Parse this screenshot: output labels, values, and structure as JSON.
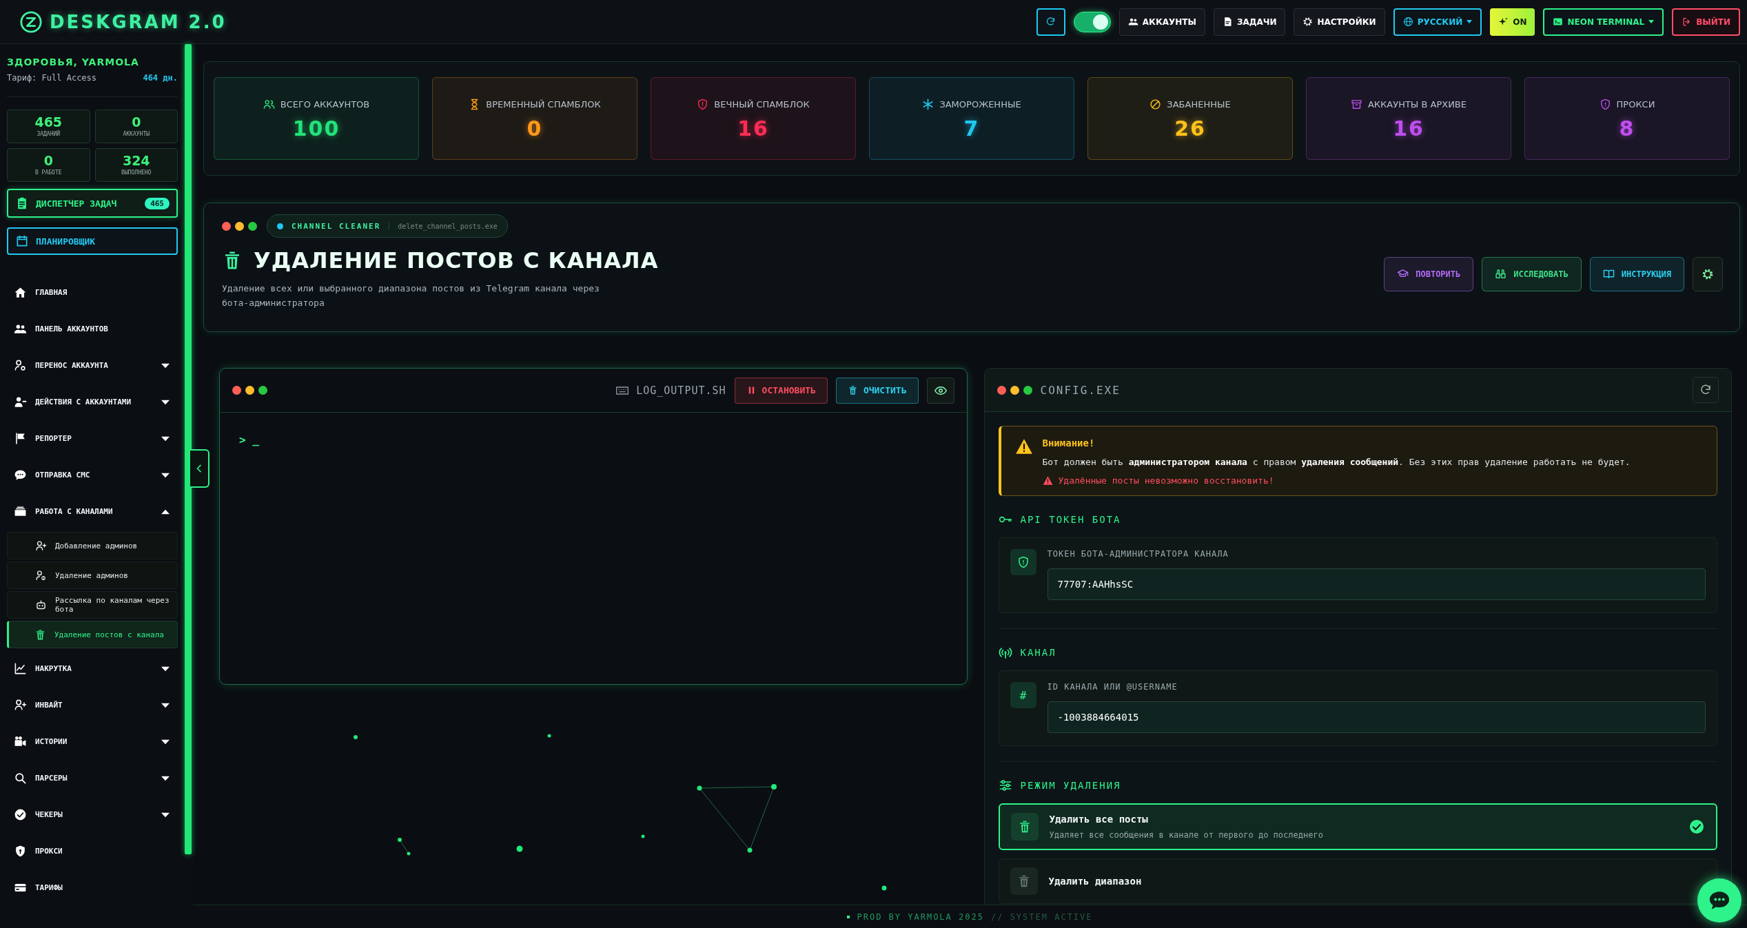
{
  "topbar": {
    "logo": "DESKGRAM 2.0",
    "switch": {
      "on": true
    },
    "buttons": [
      {
        "kind": "icon"
      },
      {
        "kind": "nav",
        "label": "АККАУНТЫ"
      },
      {
        "kind": "nav",
        "label": "ЗАДАЧИ"
      },
      {
        "kind": "nav",
        "label": "НАСТРОЙКИ"
      },
      {
        "kind": "dropdown",
        "label": "РУССКИЙ",
        "color": "#22c8f0"
      },
      {
        "kind": "effects",
        "label": "ON"
      },
      {
        "kind": "dropdown",
        "label": "NEON TERMINAL",
        "color": "#2ef28a"
      },
      {
        "kind": "logout",
        "label": "ВЫЙТИ"
      }
    ]
  },
  "sidebar": {
    "greeting": "ЗДОРОВЬЯ, YARMOLA",
    "plan": "Тариф: Full Access",
    "days_left": "464 дн.",
    "stats": [
      {
        "value": "465",
        "label": "ЗАДАНИЙ"
      },
      {
        "value": "0",
        "label": "АККАУНТЫ"
      },
      {
        "value": "0",
        "label": "В РАБОТЕ"
      },
      {
        "value": "324",
        "label": "ВЫПОЛНЕНО"
      }
    ],
    "dispatcher": {
      "label": "ДИСПЕТЧЕР ЗАДАЧ",
      "count": "465"
    },
    "scheduler": {
      "label": "ПЛАНИРОВЩИК"
    },
    "nav": [
      {
        "label": "ГЛАВНАЯ",
        "kind": "link"
      },
      {
        "label": "ПАНЕЛЬ АККАУНТОВ",
        "kind": "link"
      },
      {
        "label": "ПЕРЕНОС АККАУНТА",
        "kind": "group",
        "expanded": false
      },
      {
        "label": "ДЕЙСТВИЯ С АККАУНТАМИ",
        "kind": "group",
        "expanded": false
      },
      {
        "label": "РЕПОРТЕР",
        "kind": "group",
        "expanded": false
      },
      {
        "label": "ОТПРАВКА СМС",
        "kind": "group",
        "expanded": false
      },
      {
        "label": "РАБОТА С КАНАЛАМИ",
        "kind": "group",
        "expanded": true,
        "children": [
          {
            "label": "Добавление админов",
            "selected": false
          },
          {
            "label": "Удаление админов",
            "selected": false
          },
          {
            "label": "Рассылка по каналам через бота",
            "selected": false
          },
          {
            "label": "Удаление постов с канала",
            "selected": true
          }
        ]
      },
      {
        "label": "НАКРУТКА",
        "kind": "group",
        "expanded": false
      },
      {
        "label": "ИНВАЙТ",
        "kind": "group",
        "expanded": false
      },
      {
        "label": "ИСТОРИИ",
        "kind": "group",
        "expanded": false
      },
      {
        "label": "ПАРСЕРЫ",
        "kind": "group",
        "expanded": false
      },
      {
        "label": "ЧЕКЕРЫ",
        "kind": "group",
        "expanded": false
      },
      {
        "label": "ПРОКСИ",
        "kind": "link"
      },
      {
        "label": "ТАРИФЫ",
        "kind": "link"
      }
    ]
  },
  "stats": [
    {
      "label": "ВСЕГО АККАУНТОВ",
      "value": "100",
      "color": "#22e37a"
    },
    {
      "label": "ВРЕМЕННЫЙ СПАМБЛОК",
      "value": "0",
      "color": "#ff9a1a"
    },
    {
      "label": "ВЕЧНЫЙ СПАМБЛОК",
      "value": "16",
      "color": "#ff2d55"
    },
    {
      "label": "ЗАМОРОЖЕННЫЕ",
      "value": "7",
      "color": "#1ec8f0"
    },
    {
      "label": "ЗАБАНЕННЫЕ",
      "value": "26",
      "color": "#ffc21a"
    },
    {
      "label": "АККАУНТЫ В АРХИВЕ",
      "value": "16",
      "color": "#c04ef0"
    },
    {
      "label": "ПРОКСИ",
      "value": "8",
      "color": "#c04ef0"
    }
  ],
  "tool": {
    "tag": "CHANNEL CLEANER",
    "file": "delete_channel_posts.exe",
    "title": "УДАЛЕНИЕ ПОСТОВ С КАНАЛА",
    "description": "Удаление всех или выбранного диапазона постов из Telegram канала через бота-администратора",
    "actions": [
      {
        "label": "ПОВТОРИТЬ",
        "color": "#b36cf5"
      },
      {
        "label": "ИССЛЕДОВАТЬ",
        "color": "#3ee28a"
      },
      {
        "label": "ИНСТРУКЦИЯ",
        "color": "#2ed0f0"
      }
    ]
  },
  "log": {
    "title": "LOG_OUTPUT.SH",
    "buttons": [
      {
        "label": "ОСТАНОВИТЬ",
        "color": "#ff4d5e"
      },
      {
        "label": "ОЧИСТИТЬ",
        "color": "#2ed0f0"
      }
    ],
    "prompt": "> _"
  },
  "config": {
    "title": "CONFIG.EXE",
    "warning": {
      "title": "Внимание!",
      "text": "Бот должен быть **администратором канала** с правом **удаления сообщений**. Без этих прав удаление работать не будет.",
      "danger": "Удалённые посты невозможно восстановить!"
    },
    "sections": [
      {
        "heading": "API ТОКЕН БОТА",
        "field": {
          "label": "ТОКЕН БОТА-АДМИНИСТРАТОРА КАНАЛА",
          "value": "77707:AAHhsSC"
        }
      },
      {
        "heading": "КАНАЛ",
        "field": {
          "label": "ID КАНАЛА ИЛИ @USERNAME",
          "value": "-1003884664015",
          "badge": "#"
        }
      }
    ],
    "mode": {
      "heading": "РЕЖИМ УДАЛЕНИЯ",
      "options": [
        {
          "title": "Удалить все посты",
          "description": "Удаляет все сообщения в канале от первого до последнего",
          "selected": true
        },
        {
          "title": "Удалить диапазон",
          "selected": false
        }
      ]
    }
  },
  "footer": {
    "credit": "PROD BY YARMOLA 2025",
    "status": "// SYSTEM ACTIVE"
  }
}
